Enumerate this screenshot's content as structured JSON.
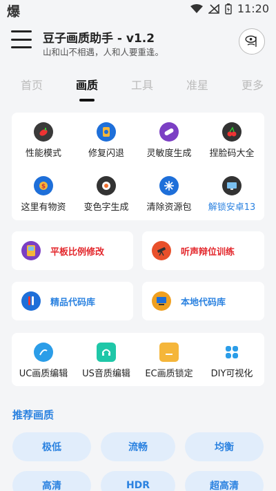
{
  "status_bar": {
    "left_glyph": "爆",
    "time": "11:20"
  },
  "header": {
    "title": "豆子画质助手 - v1.2",
    "subtitle": "山和山不相遇，人和人要重逢。"
  },
  "tabs": [
    {
      "label": "首页",
      "active": false
    },
    {
      "label": "画质",
      "active": true
    },
    {
      "label": "工具",
      "active": false
    },
    {
      "label": "准星",
      "active": false
    },
    {
      "label": "更多",
      "active": false
    }
  ],
  "grid1": [
    {
      "label": "性能模式",
      "icon": "pepper-icon",
      "color": "#3a3a3a"
    },
    {
      "label": "修复闪退",
      "icon": "phone-gear-icon",
      "color": "#1e6fd9"
    },
    {
      "label": "灵敏度生成",
      "icon": "pill-icon",
      "color": "#7b3fc4"
    },
    {
      "label": "捏脸码大全",
      "icon": "cherry-icon",
      "color": "#333333"
    },
    {
      "label": "这里有物资",
      "icon": "coin-icon",
      "color": "#1e6fd9"
    },
    {
      "label": "变色字生成",
      "icon": "sushi-icon",
      "color": "#333333"
    },
    {
      "label": "清除资源包",
      "icon": "snowflake-icon",
      "color": "#1e6fd9"
    },
    {
      "label": "解锁安卓13",
      "icon": "monitor-icon",
      "color": "#333333",
      "highlight": true
    }
  ],
  "wide_buttons_1": [
    {
      "label": "平板比例修改",
      "icon": "gameboy-icon",
      "color": "#7b3fc4",
      "text_color": "#e3262b"
    },
    {
      "label": "听声辩位训练",
      "icon": "telescope-icon",
      "color": "#e8502b",
      "text_color": "#e3262b"
    }
  ],
  "wide_buttons_2": [
    {
      "label": "精品代码库",
      "icon": "test-tube-icon",
      "color": "#1e6fd9",
      "text_color": "#2b82e0"
    },
    {
      "label": "本地代码库",
      "icon": "computer-icon",
      "color": "#f0a020",
      "text_color": "#2b82e0"
    }
  ],
  "grid2": [
    {
      "label": "UC画质编辑",
      "icon": "uc-icon",
      "color": "#2b9de8"
    },
    {
      "label": "US音质编辑",
      "icon": "headphone-icon",
      "color": "#1fc7a8"
    },
    {
      "label": "EC画质锁定",
      "icon": "card-icon",
      "color": "#f5b63a"
    },
    {
      "label": "DIY可视化",
      "icon": "diy-icon",
      "color": "#2b9de8"
    }
  ],
  "section_title": "推荐画质",
  "quality_options": [
    "极低",
    "流畅",
    "均衡",
    "高清",
    "HDR",
    "超高清"
  ]
}
